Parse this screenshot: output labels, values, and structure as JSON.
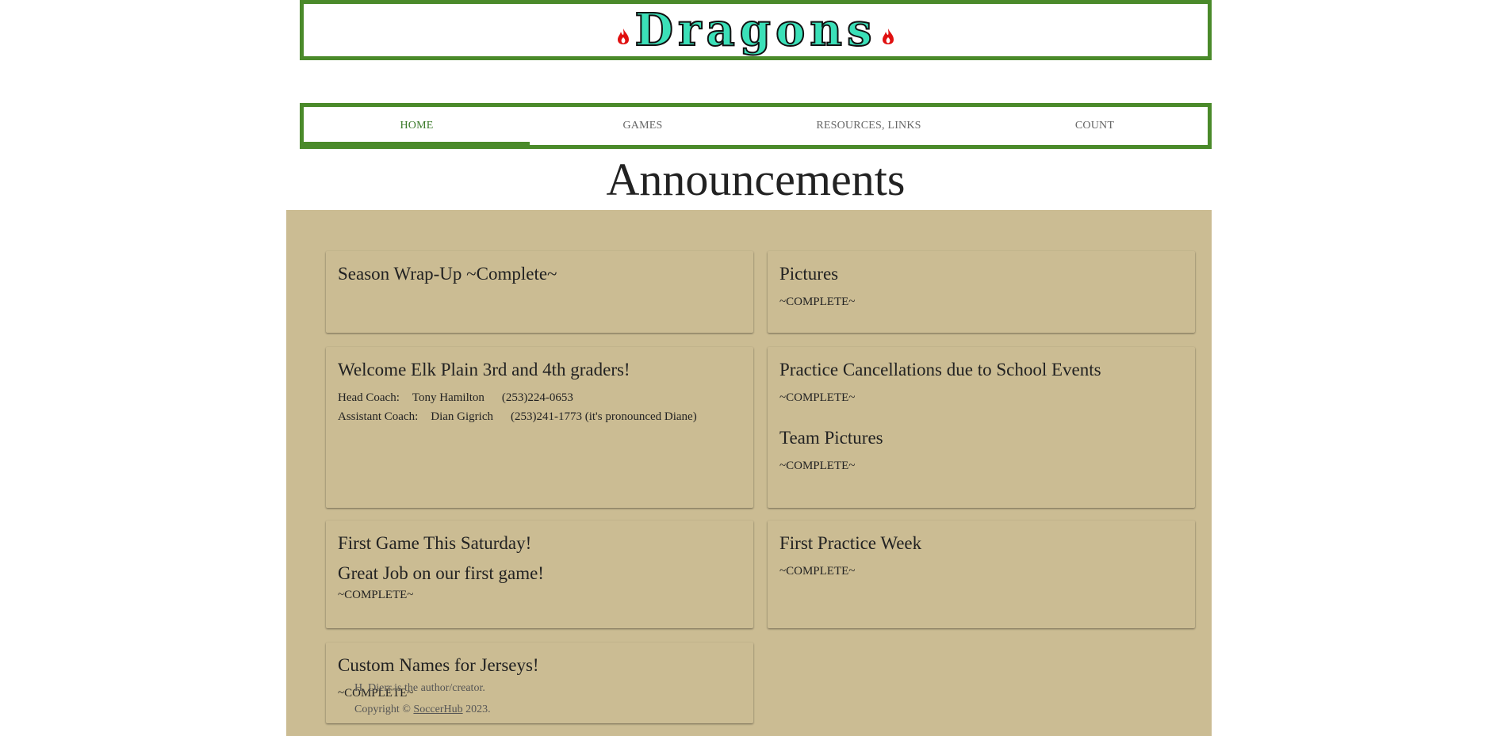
{
  "header": {
    "title": "Dragons",
    "flame_color": "#e01010",
    "title_color": "#3be0b8",
    "border_color": "#4a8a2a"
  },
  "nav": {
    "items": [
      {
        "label": "HOME",
        "active": true
      },
      {
        "label": "GAMES",
        "active": false
      },
      {
        "label": "RESOURCES, LINKS",
        "active": false
      },
      {
        "label": "COUNT",
        "active": false
      }
    ]
  },
  "main": {
    "heading": "Announcements",
    "board_color": "#cbbc93",
    "cards": {
      "season_wrap": {
        "title": "Season Wrap-Up ~Complete~"
      },
      "pictures": {
        "title": "Pictures",
        "status": "~COMPLETE~"
      },
      "welcome": {
        "title": "Welcome Elk Plain 3rd and 4th graders!",
        "head_coach_label": "Head Coach:",
        "head_coach_name": "Tony Hamilton",
        "head_coach_phone": "(253)224-0653",
        "assistant_coach_label": "Assistant Coach:",
        "assistant_coach_name": "Dian Gigrich",
        "assistant_coach_phone": "(253)241-1773 (it's pronounced Diane)"
      },
      "cancellations": {
        "title": "Practice Cancellations due to School Events",
        "status": "~COMPLETE~",
        "title2": "Team Pictures",
        "status2": "~COMPLETE~"
      },
      "first_game": {
        "title": "First Game This Saturday!",
        "title2": "Great Job on our first game!",
        "status": "~COMPLETE~"
      },
      "first_practice": {
        "title": "First Practice Week",
        "status": "~COMPLETE~"
      },
      "jerseys": {
        "title": "Custom Names for Jerseys!",
        "status": "~COMPLETE~"
      }
    }
  },
  "footer": {
    "author_line": "H. Dierr is the author/creator.",
    "copyright_prefix": "Copyright © ",
    "copyright_link": "SoccerHub",
    "copyright_suffix": " 2023."
  }
}
